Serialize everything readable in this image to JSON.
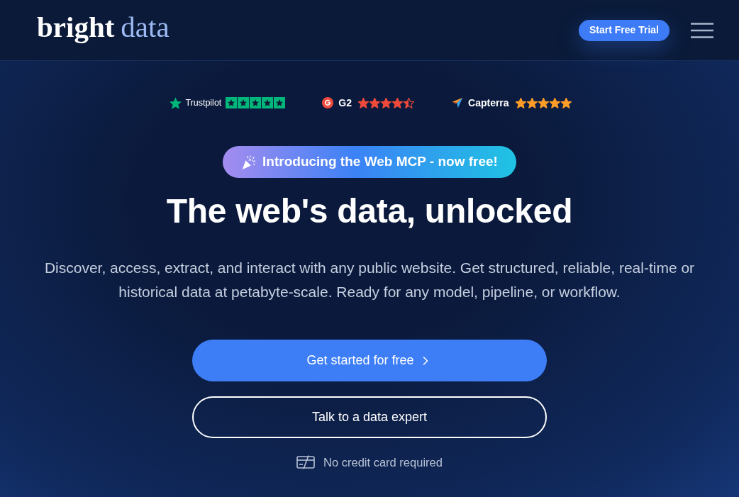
{
  "header": {
    "logo": [
      "bright",
      "data"
    ],
    "cta": "Start Free Trial"
  },
  "ratings": [
    {
      "kind": "trustpilot",
      "name": "Trustpilot",
      "stars": 5
    },
    {
      "kind": "g2",
      "name": "G2",
      "stars": 4.5
    },
    {
      "kind": "capterra",
      "name": "Capterra",
      "stars": 5
    }
  ],
  "announcement": "Introducing the Web MCP - now free!",
  "headline": "The web's data, unlocked",
  "description": "Discover, access, extract, and interact with any public website. Get structured, reliable, real-time or historical data at petabyte-scale. Ready for any model, pipeline, or workflow.",
  "buttons": [
    {
      "kind": "primary",
      "label": "Get started for free"
    },
    {
      "kind": "outline",
      "label": "Talk to a data expert"
    }
  ],
  "note": "No credit card required"
}
